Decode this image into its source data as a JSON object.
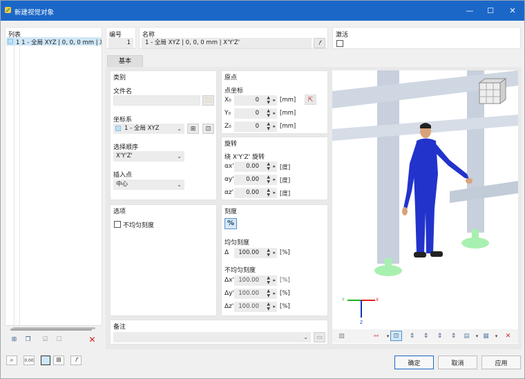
{
  "window": {
    "title": "新建视觉对象",
    "minimize": "—",
    "maximize": "☐",
    "close": "✕"
  },
  "list": {
    "header": "列表",
    "items": [
      {
        "label": "1  1 - 全局 XYZ | 0, 0, 0 mm | X'Y'Z'"
      }
    ]
  },
  "number": {
    "label": "编号",
    "value": "1"
  },
  "name": {
    "label": "名称",
    "value": "1 - 全局 XYZ | 0, 0, 0 mm | X'Y'Z'"
  },
  "activate": {
    "label": "激活"
  },
  "tabs": {
    "basic": "基本"
  },
  "category": {
    "header": "类别",
    "file_name_label": "文件名",
    "coord_system_label": "坐标系",
    "coord_system_value": "1 - 全局 XYZ",
    "order_label": "选择顺序",
    "order_value": "X'Y'Z'",
    "insert_label": "插入点",
    "insert_value": "中心"
  },
  "origin": {
    "header": "原点",
    "point_coords_label": "点坐标",
    "rows": [
      {
        "axis": "X₀",
        "value": "0",
        "unit": "[mm]"
      },
      {
        "axis": "Y₀",
        "value": "0",
        "unit": "[mm]"
      },
      {
        "axis": "Z₀",
        "value": "0",
        "unit": "[mm]"
      }
    ]
  },
  "rotation": {
    "header": "旋转",
    "about_label": "绕 X'Y'Z' 旋转",
    "rows": [
      {
        "axis": "αx'",
        "value": "0.00",
        "unit": "[度]"
      },
      {
        "axis": "αy'",
        "value": "0.00",
        "unit": "[度]"
      },
      {
        "axis": "αz'",
        "value": "0.00",
        "unit": "[度]"
      }
    ]
  },
  "options": {
    "header": "选项",
    "nonuniform_label": "不均匀刻度"
  },
  "scale": {
    "header": "刻度",
    "percent_btn": "%",
    "uniform_label": "均匀刻度",
    "uniform_row": {
      "axis": "Δ",
      "value": "100.00",
      "unit": "[%]"
    },
    "nonuniform_label": "不均匀刻度",
    "nonuniform_rows": [
      {
        "axis": "Δx'",
        "value": "100.00",
        "unit": "[%]"
      },
      {
        "axis": "Δy'",
        "value": "100.00",
        "unit": "[%]"
      },
      {
        "axis": "Δz'",
        "value": "100.00",
        "unit": "[%]"
      }
    ]
  },
  "comment": {
    "header": "备注"
  },
  "axes": {
    "x": "X",
    "y": "Y",
    "z": "Z"
  },
  "footer": {
    "ok": "确定",
    "cancel": "取消",
    "apply": "应用",
    "units_icon_text": "0.00"
  },
  "colors": {
    "accent": "#1b67c8",
    "list_select": "#cfe7f7",
    "figure": "#2233cc",
    "column": "#c7d0dc",
    "support": "#a8f0b0"
  }
}
